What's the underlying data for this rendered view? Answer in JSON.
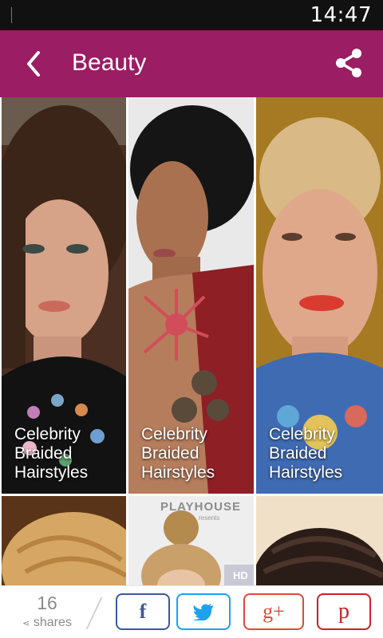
{
  "status_bar": {
    "time": "14:47"
  },
  "app_bar": {
    "title": "Beauty",
    "back_icon": "chevron-left-icon",
    "share_icon": "share-icon",
    "color": "#9b1d63"
  },
  "grid": {
    "tiles": [
      {
        "caption": "Celebrity\nBraided\nHairstyles"
      },
      {
        "caption": "Celebrity\nBraided\nHairstyles"
      },
      {
        "caption": "Celebrity\nBraided\nHairstyles"
      },
      {
        "caption": ""
      },
      {
        "caption": "",
        "backdrop_text": "PLAYHOUSE",
        "backdrop_subtext": "resents",
        "badge": "HD"
      },
      {
        "caption": ""
      }
    ]
  },
  "share_bar": {
    "count": "16",
    "count_label": "shares",
    "buttons": [
      {
        "icon": "facebook-icon",
        "glyph": "f"
      },
      {
        "icon": "twitter-icon"
      },
      {
        "icon": "google-plus-icon",
        "glyph": "g+"
      },
      {
        "icon": "pinterest-icon",
        "glyph": "p"
      }
    ]
  }
}
